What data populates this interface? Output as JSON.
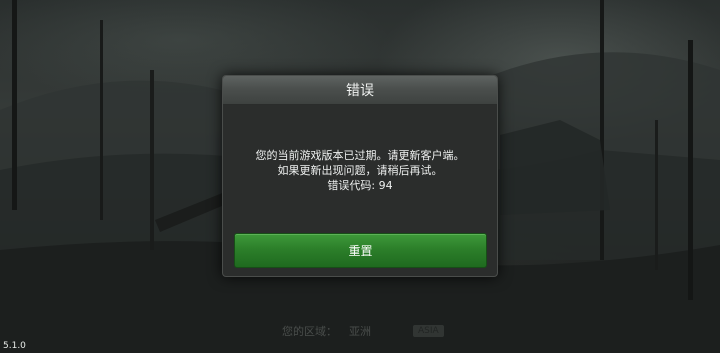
{
  "dialog": {
    "title": "错误",
    "message_line1": "您的当前游戏版本已过期。请更新客户端。",
    "message_line2": "如果更新出现问题，请稍后再试。",
    "error_code_line": "错误代码: 94",
    "reset_label": "重置"
  },
  "footer": {
    "region_label": "您的区域：",
    "region_value": "亚洲",
    "region_badge": "ASIA"
  },
  "version": "5.1.0",
  "colors": {
    "button_green": "#2c7f2a",
    "dialog_bg": "#2b2d2c",
    "header_gray": "#4b4f4d"
  }
}
